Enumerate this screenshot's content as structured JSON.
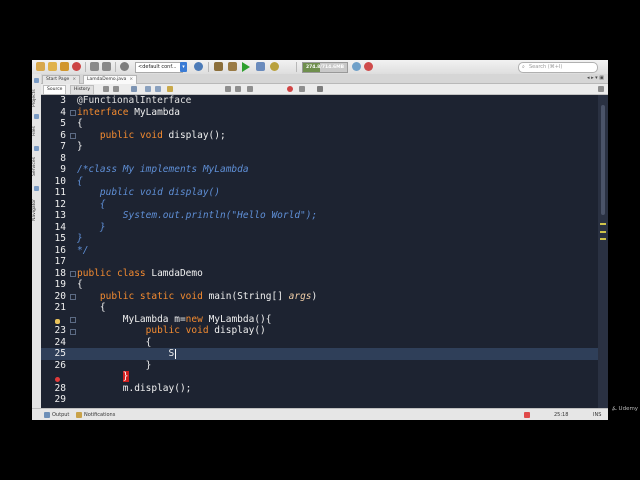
{
  "toolbar": {
    "config_select": "<default conf...",
    "memory": {
      "text": "274.8/714.6MB",
      "fill_fraction": 0.38
    },
    "search_placeholder": "Search (⌘+I)",
    "icons": [
      "new-file-icon",
      "new-project-icon",
      "open-project-icon",
      "close-icon",
      "undo-icon",
      "redo-icon",
      "clean-build-icon",
      "build-icon",
      "run-icon",
      "debug-icon",
      "profile-icon",
      "gc-icon",
      "stop-icon"
    ]
  },
  "left_panels": [
    "Projects",
    "Files",
    "Services",
    "Navigator"
  ],
  "file_tabs": {
    "items": [
      {
        "label": "Start Page",
        "active": false
      },
      {
        "label": "LamdaDemo.java",
        "active": true
      }
    ],
    "close_glyph": "×",
    "controls": "◂ ▸ ▾ ▣"
  },
  "editor_toolbar": {
    "source_label": "Source",
    "history_label": "History"
  },
  "editor": {
    "current_line": 25,
    "lines": [
      {
        "n": "3",
        "tokens": [
          {
            "t": "@FunctionalInterface",
            "c": "ann"
          }
        ]
      },
      {
        "n": "4",
        "tokens": [
          {
            "t": "interface ",
            "c": "kw"
          },
          {
            "t": "MyLambda",
            "c": "id"
          }
        ]
      },
      {
        "n": "5",
        "tokens": [
          {
            "t": "{",
            "c": "id"
          }
        ]
      },
      {
        "n": "6",
        "tokens": [
          {
            "t": "    public void ",
            "c": "kw"
          },
          {
            "t": "display();",
            "c": "id"
          }
        ]
      },
      {
        "n": "7",
        "tokens": [
          {
            "t": "}",
            "c": "id"
          }
        ]
      },
      {
        "n": "8",
        "tokens": []
      },
      {
        "n": "9",
        "tokens": [
          {
            "t": "/*class My implements MyLambda",
            "c": "cm"
          }
        ]
      },
      {
        "n": "10",
        "tokens": [
          {
            "t": "{",
            "c": "cm"
          }
        ]
      },
      {
        "n": "11",
        "tokens": [
          {
            "t": "    public void display()",
            "c": "cm"
          }
        ]
      },
      {
        "n": "12",
        "tokens": [
          {
            "t": "    {",
            "c": "cm"
          }
        ]
      },
      {
        "n": "13",
        "tokens": [
          {
            "t": "        System.out.println(\"Hello World\");",
            "c": "cm"
          }
        ]
      },
      {
        "n": "14",
        "tokens": [
          {
            "t": "    }",
            "c": "cm"
          }
        ]
      },
      {
        "n": "15",
        "tokens": [
          {
            "t": "}",
            "c": "cm"
          }
        ]
      },
      {
        "n": "16",
        "tokens": [
          {
            "t": "*/",
            "c": "cm"
          }
        ]
      },
      {
        "n": "17",
        "tokens": []
      },
      {
        "n": "18",
        "tokens": [
          {
            "t": "public class ",
            "c": "kw"
          },
          {
            "t": "LamdaDemo",
            "c": "id"
          }
        ]
      },
      {
        "n": "19",
        "tokens": [
          {
            "t": "{",
            "c": "id"
          }
        ]
      },
      {
        "n": "20",
        "tokens": [
          {
            "t": "    public static void ",
            "c": "kw"
          },
          {
            "t": "main(String[] ",
            "c": "id"
          },
          {
            "t": "args",
            "c": "par"
          },
          {
            "t": ")",
            "c": "id"
          }
        ]
      },
      {
        "n": "21",
        "tokens": [
          {
            "t": "    {",
            "c": "id"
          }
        ]
      },
      {
        "n": "",
        "tokens": [
          {
            "t": "        MyLambda m=",
            "c": "id"
          },
          {
            "t": "new ",
            "c": "kw"
          },
          {
            "t": "MyLambda(){",
            "c": "id"
          }
        ]
      },
      {
        "n": "23",
        "tokens": [
          {
            "t": "            public void ",
            "c": "kw"
          },
          {
            "t": "display()",
            "c": "id"
          }
        ]
      },
      {
        "n": "24",
        "tokens": [
          {
            "t": "            {",
            "c": "id"
          }
        ]
      },
      {
        "n": "25",
        "tokens": [
          {
            "t": "                S",
            "c": "id"
          }
        ]
      },
      {
        "n": "26",
        "tokens": [
          {
            "t": "            }",
            "c": "id"
          }
        ]
      },
      {
        "n": "",
        "tokens": [
          {
            "t": "        ",
            "c": "id"
          },
          {
            "t": "}",
            "c": "err"
          }
        ]
      },
      {
        "n": "28",
        "tokens": [
          {
            "t": "        m.display();",
            "c": "id"
          }
        ]
      },
      {
        "n": "29",
        "tokens": []
      }
    ]
  },
  "status_bar": {
    "output_label": "Output",
    "notifications_label": "Notifications",
    "caret_position": "25:18",
    "insert_mode": "INS"
  },
  "watermark": "Udemy",
  "colors": {
    "editor_bg": "#1d2331",
    "keyword": "#f48b30",
    "comment": "#5f8fd6",
    "current_line": "#2f3f59",
    "error_bg": "#d21f1f"
  }
}
